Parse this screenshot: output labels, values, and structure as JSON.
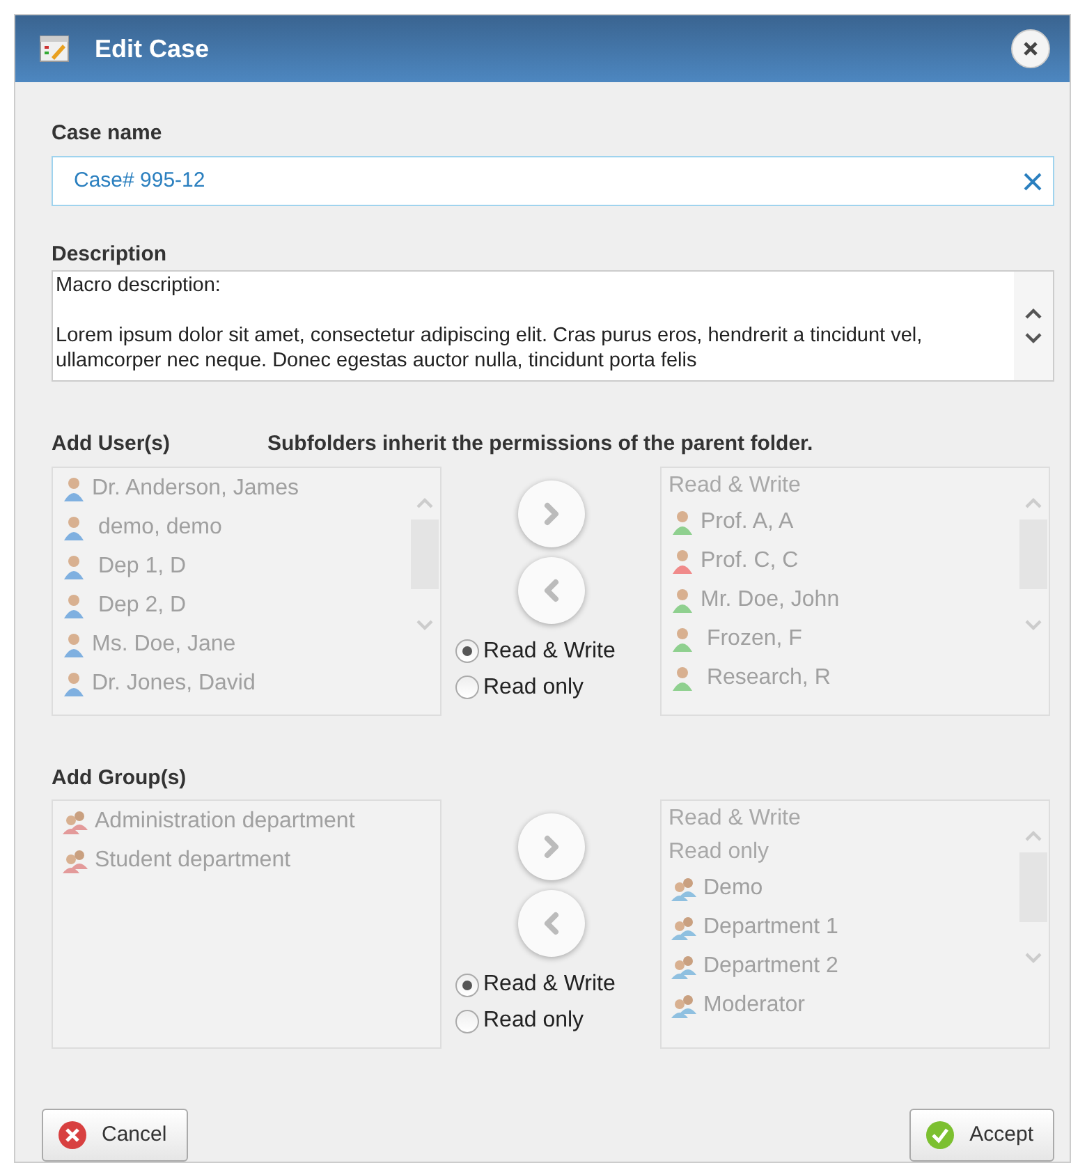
{
  "window": {
    "title": "Edit Case"
  },
  "case_name": {
    "label": "Case name",
    "value": "Case# 995-12"
  },
  "description": {
    "label": "Description",
    "paragraphs": [
      "Macro description:",
      "Lorem ipsum dolor sit amet, consectetur adipiscing elit. Cras purus eros, hendrerit a tincidunt vel, ullamcorper nec neque. Donec egestas auctor nulla, tincidunt porta felis"
    ]
  },
  "users": {
    "label": "Add User(s)",
    "note": "Subfolders inherit the permissions of the parent folder.",
    "available": [
      {
        "kind": "user",
        "text": "Dr. Anderson, James",
        "color": "#7fb0e0"
      },
      {
        "kind": "user",
        "text": " demo, demo",
        "color": "#7fb0e0"
      },
      {
        "kind": "user",
        "text": " Dep 1, D",
        "color": "#7fb0e0"
      },
      {
        "kind": "user",
        "text": " Dep 2, D",
        "color": "#7fb0e0"
      },
      {
        "kind": "user",
        "text": "Ms. Doe, Jane",
        "color": "#7fb0e0"
      },
      {
        "kind": "user",
        "text": "Dr. Jones, David",
        "color": "#7fb0e0"
      }
    ],
    "permissions": [
      {
        "label": "Read & Write",
        "selected": true
      },
      {
        "label": "Read only",
        "selected": false
      }
    ],
    "assigned": [
      {
        "kind": "header",
        "text": "Read & Write"
      },
      {
        "kind": "user",
        "text": "Prof. A, A",
        "color": "#8fd08f"
      },
      {
        "kind": "user",
        "text": "Prof. C, C",
        "color": "#f08a8a"
      },
      {
        "kind": "user",
        "text": "Mr. Doe, John",
        "color": "#8fd08f"
      },
      {
        "kind": "user",
        "text": " Frozen, F",
        "color": "#8fd08f"
      },
      {
        "kind": "user",
        "text": " Research, R",
        "color": "#8fd08f"
      }
    ]
  },
  "groups": {
    "label": "Add Group(s)",
    "available": [
      {
        "kind": "group",
        "text": "Administration department",
        "color": "#e39a9a"
      },
      {
        "kind": "group",
        "text": "Student department",
        "color": "#e39a9a"
      }
    ],
    "permissions": [
      {
        "label": "Read & Write",
        "selected": true
      },
      {
        "label": "Read only",
        "selected": false
      }
    ],
    "assigned": [
      {
        "kind": "header",
        "text": "Read & Write"
      },
      {
        "kind": "header",
        "text": "Read only"
      },
      {
        "kind": "group",
        "text": "Demo",
        "color": "#8fc0e0"
      },
      {
        "kind": "group",
        "text": "Department 1",
        "color": "#8fc0e0"
      },
      {
        "kind": "group",
        "text": "Department 2",
        "color": "#8fc0e0"
      },
      {
        "kind": "group",
        "text": "Moderator",
        "color": "#8fc0e0"
      }
    ]
  },
  "buttons": {
    "cancel": "Cancel",
    "accept": "Accept"
  }
}
